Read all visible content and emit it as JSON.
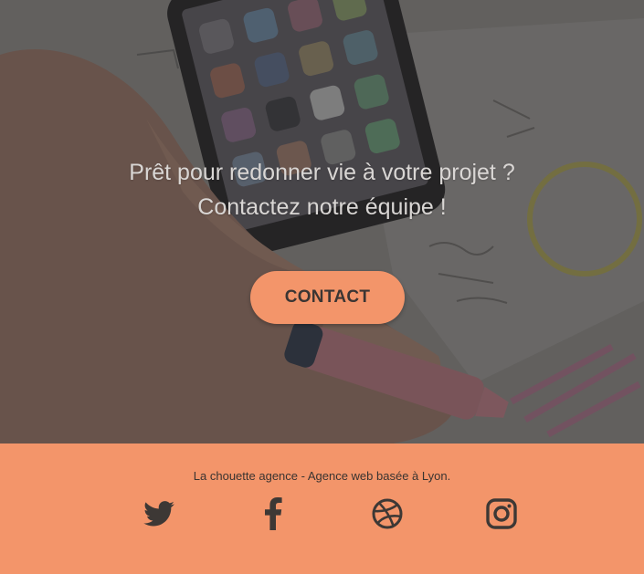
{
  "hero": {
    "line1": "Prêt pour redonner vie à votre projet ?",
    "line2": "Contactez notre équipe !",
    "cta_label": "CONTACT"
  },
  "footer": {
    "tagline": "La chouette agence - Agence web basée à Lyon.",
    "social": [
      {
        "name": "twitter-icon"
      },
      {
        "name": "facebook-icon"
      },
      {
        "name": "dribbble-icon"
      },
      {
        "name": "instagram-icon"
      }
    ]
  },
  "colors": {
    "accent": "#f3956a",
    "footer_text": "#3a3431",
    "icon": "#3d3835",
    "hero_text": "#d9d6d4"
  }
}
